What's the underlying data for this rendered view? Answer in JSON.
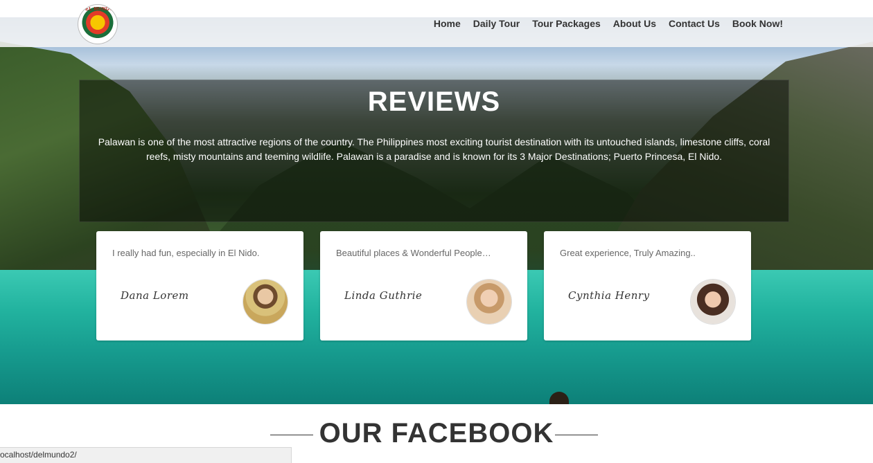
{
  "brand": {
    "logo_text": "DEL MUNDO"
  },
  "nav": [
    {
      "label": "Home"
    },
    {
      "label": "Daily Tour"
    },
    {
      "label": "Tour Packages"
    },
    {
      "label": "About Us"
    },
    {
      "label": "Contact Us"
    },
    {
      "label": "Book Now!"
    }
  ],
  "reviews": {
    "title": "REVIEWS",
    "text": "Palawan is one of the most attractive regions of the country. The Philippines most exciting tourist destination with its untouched islands, limestone cliffs, coral reefs, misty mountains and teeming wildlife. Palawan is a paradise and is known for its 3 Major Destinations; Puerto Princesa, El Nido.",
    "cards": [
      {
        "quote": "I really had fun, especially in El Nido.",
        "signature": "Dana Lorem"
      },
      {
        "quote": "Beautiful places & Wonderful People…",
        "signature": "Linda Guthrie"
      },
      {
        "quote": "Great experience, Truly Amazing..",
        "signature": "Cynthia Henry"
      }
    ]
  },
  "facebook": {
    "title": "OUR FACEBOOK"
  },
  "status_bar": {
    "url": "ocalhost/delmundo2/"
  }
}
